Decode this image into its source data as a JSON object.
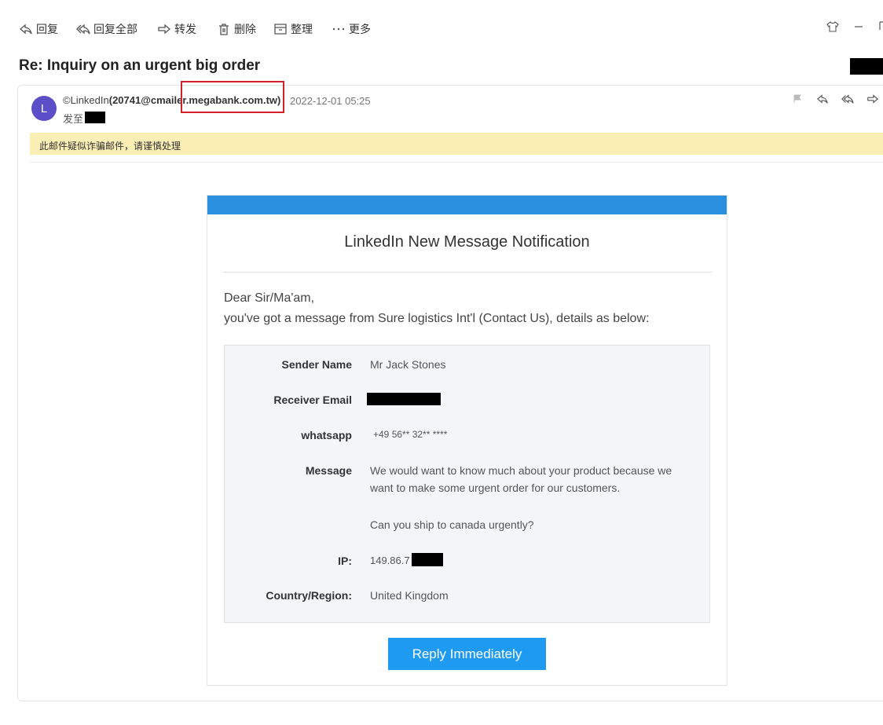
{
  "toolbar": {
    "reply": "回复",
    "reply_all": "回复全部",
    "forward": "转发",
    "delete": "删除",
    "organize": "整理",
    "more": "更多"
  },
  "mail": {
    "subject": "Re: Inquiry on an urgent big order",
    "avatar_initial": "L",
    "from_name": "©LinkedIn",
    "from_address": "(20741@cmailer.megabank.com.tw)",
    "date": "2022-12-01 05:25",
    "to_label": "发至",
    "warning": "此邮件疑似诈骗邮件，请谨慎处理"
  },
  "notification": {
    "title": "LinkedIn New Message Notification",
    "greeting": "Dear Sir/Ma'am,",
    "intro": "you've got a message from Sure logistics  Int'l (Contact Us), details as below:",
    "details": {
      "sender_label": "Sender Name",
      "sender_value": "Mr Jack Stones",
      "receiver_label": "Receiver Email",
      "whatsapp_label": "whatsapp",
      "whatsapp_value": "+49 56** 32** ****",
      "message_label": "Message",
      "message_line1": "We would want to know much about your product because we want to make some urgent order for our customers.",
      "message_line2": "Can you ship to canada urgently?",
      "ip_label": "IP:",
      "ip_value": "149.86.7",
      "country_label": "Country/Region:",
      "country_value": "United Kingdom"
    },
    "button": "Reply Immediately"
  },
  "colors": {
    "accent_bar": "#2b8fe0",
    "button": "#1e9bf0",
    "warning_bg": "#fcefb6",
    "avatar": "#5b4ec7",
    "highlight": "#d4202a"
  },
  "icons": [
    "reply-icon",
    "reply-all-icon",
    "forward-icon",
    "trash-icon",
    "organize-icon",
    "more-icon",
    "shirt-icon",
    "minimize-icon",
    "flag-icon"
  ]
}
